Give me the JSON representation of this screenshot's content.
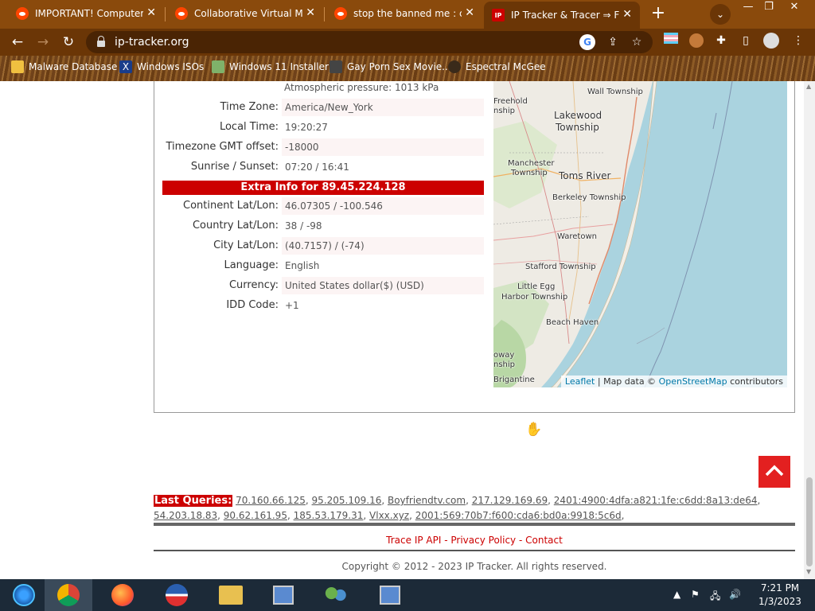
{
  "browser": {
    "tabs": [
      {
        "title": "IMPORTANT! Computer...",
        "favicon": "reddit-icon",
        "active": false
      },
      {
        "title": "Collaborative Virtual Mach...",
        "favicon": "reddit-icon",
        "active": false
      },
      {
        "title": "stop the banned me : colla...",
        "favicon": "reddit-icon",
        "active": false
      },
      {
        "title": "IP Tracker & Tracer ⇒ Fi...",
        "favicon": "ip-icon",
        "favicon_text": "IP",
        "active": true
      }
    ],
    "url": "ip-tracker.org",
    "bookmarks": [
      {
        "label": "Malware Database",
        "icon": "folder-icon"
      },
      {
        "label": "Windows ISOs",
        "icon": "x-icon"
      },
      {
        "label": "Windows 11 Installer",
        "icon": "image-icon"
      },
      {
        "label": "Gay Porn Sex Movie...",
        "icon": "site-icon"
      },
      {
        "label": "Espectral McGee",
        "icon": "profile-icon"
      }
    ]
  },
  "page": {
    "pressure_text": "Atmospheric pressure: 1013 kPa",
    "rows_top": [
      {
        "label": "Time Zone:",
        "value": "America/New_York"
      },
      {
        "label": "Local Time:",
        "value": "19:20:27"
      },
      {
        "label": "Timezone GMT offset:",
        "value": "-18000"
      },
      {
        "label": "Sunrise / Sunset:",
        "value": "07:20 / 16:41"
      }
    ],
    "extra_header": "Extra Info for 89.45.224.128",
    "rows_extra": [
      {
        "label": "Continent Lat/Lon:",
        "value": "46.07305 / -100.546"
      },
      {
        "label": "Country Lat/Lon:",
        "value": "38 / -98"
      },
      {
        "label": "City Lat/Lon:",
        "value": "(40.7157) / (-74)"
      },
      {
        "label": "Language:",
        "value": "English"
      },
      {
        "label": "Currency:",
        "value": "United States dollar($) (USD)"
      },
      {
        "label": "IDD Code:",
        "value": "+1"
      }
    ],
    "map": {
      "labels": [
        "Freehold",
        "nship",
        "Wall Township",
        "Lakewood",
        "Township",
        "Manchester",
        "Township",
        "Toms River",
        "Berkeley Township",
        "Waretown",
        "Stafford Township",
        "Little Egg",
        "Harbor Township",
        "Beach Haven",
        "oway",
        "nship",
        "Brigantine"
      ],
      "attribution": {
        "leaflet": "Leaflet",
        "sep": "| Map data ©",
        "osm": "OpenStreetMap",
        "suffix": "contributors"
      }
    },
    "last_queries": {
      "label": "Last Queries:",
      "items": [
        "70.160.66.125",
        "95.205.109.16",
        "Boyfriendtv.com",
        "217.129.169.69",
        "2401:4900:4dfa:a821:1fe:c6dd:8a13:de64",
        "54.203.18.83",
        "90.62.161.95",
        "185.53.179.31",
        "Vlxx.xyz",
        "2001:569:70b7:f600:cda6:bd0a:9918:5c6d"
      ]
    },
    "footer": {
      "links": [
        "Trace IP API",
        "Privacy Policy",
        "Contact"
      ],
      "separator": " - ",
      "copyright": "Copyright © 2012 - 2023 IP Tracker. All rights reserved."
    }
  },
  "taskbar": {
    "time": "7:21 PM",
    "date": "1/3/2023",
    "apps": [
      "start-button",
      "chrome-icon",
      "firefox-icon",
      "obama-icon",
      "file-explorer-icon",
      "network-tool-icon",
      "users-icon",
      "network-tool-2-icon"
    ]
  },
  "colors": {
    "accent_red": "#cc0000",
    "chrome_frame": "#8a4a0c",
    "taskbar": "#1c2a38"
  }
}
